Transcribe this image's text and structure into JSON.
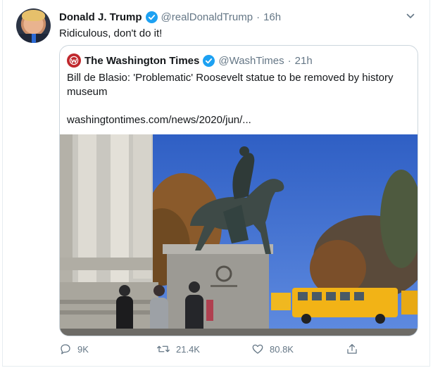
{
  "tweet": {
    "author_name": "Donald J. Trump",
    "author_handle": "@realDonaldTrump",
    "separator": "·",
    "time": "16h",
    "text": "Ridiculous, don't do it!"
  },
  "quote": {
    "author_name": "The Washington Times",
    "author_handle": "@WashTimes",
    "separator": "·",
    "time": "21h",
    "text": "Bill de Blasio: 'Problematic' Roosevelt statue to be removed by history museum",
    "link": "washingtontimes.com/news/2020/jun/..."
  },
  "actions": {
    "reply_count": "9K",
    "retweet_count": "21.4K",
    "like_count": "80.8K"
  },
  "colors": {
    "verified": "#1da1f2",
    "secondary_text": "#657786",
    "border": "#ccd6dd",
    "washtimes_brand": "#c0282d"
  },
  "icons": [
    "verified-badge-icon",
    "chevron-down-icon",
    "reply-icon",
    "retweet-icon",
    "like-icon",
    "share-icon"
  ]
}
